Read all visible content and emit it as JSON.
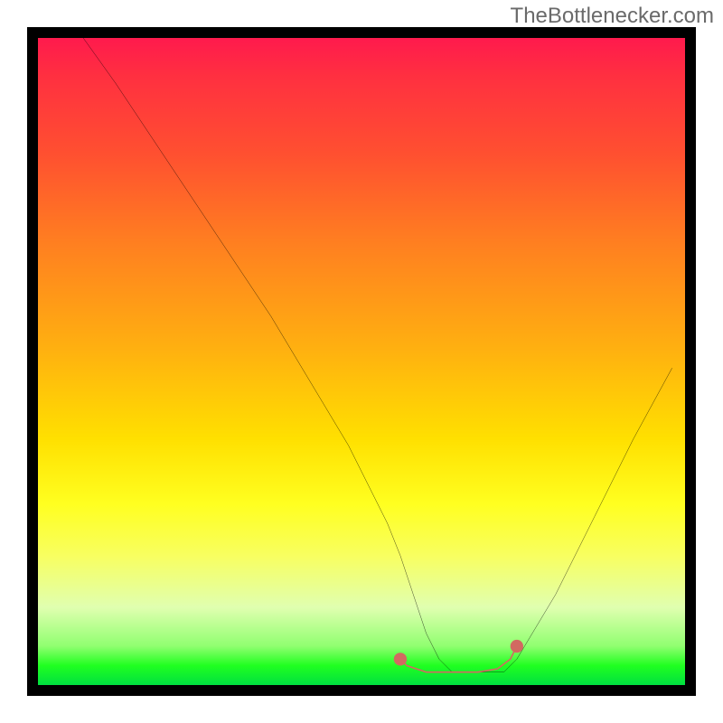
{
  "watermark": "TheBottlenecker.com",
  "chart_data": {
    "type": "line",
    "title": "",
    "xlabel": "",
    "ylabel": "",
    "xlim": [
      0,
      100
    ],
    "ylim": [
      0,
      100
    ],
    "grid": false,
    "legend": false,
    "series": [
      {
        "name": "bottleneck-curve",
        "color": "#000000",
        "x": [
          7,
          12,
          18,
          24,
          30,
          36,
          42,
          48,
          54,
          56,
          58,
          60,
          62,
          64,
          67,
          70,
          72,
          74,
          80,
          86,
          92,
          98
        ],
        "y": [
          100,
          93,
          84,
          75,
          66,
          57,
          47,
          37,
          25,
          20,
          14,
          8,
          4,
          2,
          2,
          2,
          2,
          4,
          14,
          26,
          38,
          49
        ]
      },
      {
        "name": "optimal-range-highlight",
        "color": "#d26961",
        "x": [
          56,
          57,
          60,
          64,
          68,
          71,
          73,
          74
        ],
        "y": [
          4,
          3,
          2,
          2,
          2,
          2.5,
          4,
          6
        ]
      }
    ],
    "markers": [
      {
        "name": "optimal-start-dot",
        "x": 56,
        "y": 4,
        "color": "#d26961",
        "size": 6
      },
      {
        "name": "optimal-end-dot",
        "x": 74,
        "y": 6,
        "color": "#d26961",
        "size": 6
      }
    ],
    "background_gradient": {
      "top": "#ff1a4d",
      "middle": "#ffff20",
      "bottom": "#00e040"
    }
  }
}
